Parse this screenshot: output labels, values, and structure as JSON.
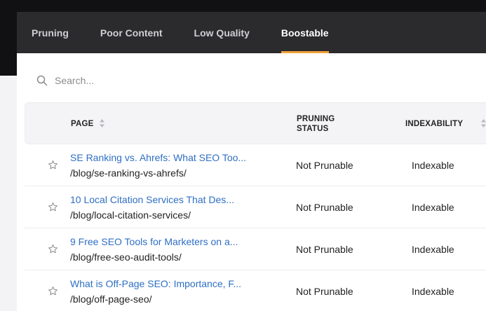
{
  "tabs": [
    {
      "label": "Pruning",
      "active": false
    },
    {
      "label": "Poor Content",
      "active": false
    },
    {
      "label": "Low Quality",
      "active": false
    },
    {
      "label": "Boostable",
      "active": true
    }
  ],
  "colors": {
    "accent": "#f2a23b",
    "link": "#2f6fc3",
    "tab_bar": "#2b2b2e",
    "top_bar": "#111113"
  },
  "search": {
    "placeholder": "Search...",
    "value": "",
    "icon": "search-icon"
  },
  "table": {
    "headers": {
      "page": "PAGE",
      "pruning_status_line1": "PRUNING",
      "pruning_status_line2": "STATUS",
      "indexability": "INDEXABILITY"
    },
    "rows": [
      {
        "title": "SE Ranking vs. Ahrefs: What SEO Too...",
        "path": "/blog/se-ranking-vs-ahrefs/",
        "status": "Not Prunable",
        "indexability": "Indexable"
      },
      {
        "title": "10 Local Citation Services That Des...",
        "path": "/blog/local-citation-services/",
        "status": "Not Prunable",
        "indexability": "Indexable"
      },
      {
        "title": "9 Free SEO Tools for Marketers on a...",
        "path": "/blog/free-seo-audit-tools/",
        "status": "Not Prunable",
        "indexability": "Indexable"
      },
      {
        "title": "What is Off-Page SEO: Importance, F...",
        "path": "/blog/off-page-seo/",
        "status": "Not Prunable",
        "indexability": "Indexable"
      }
    ]
  }
}
